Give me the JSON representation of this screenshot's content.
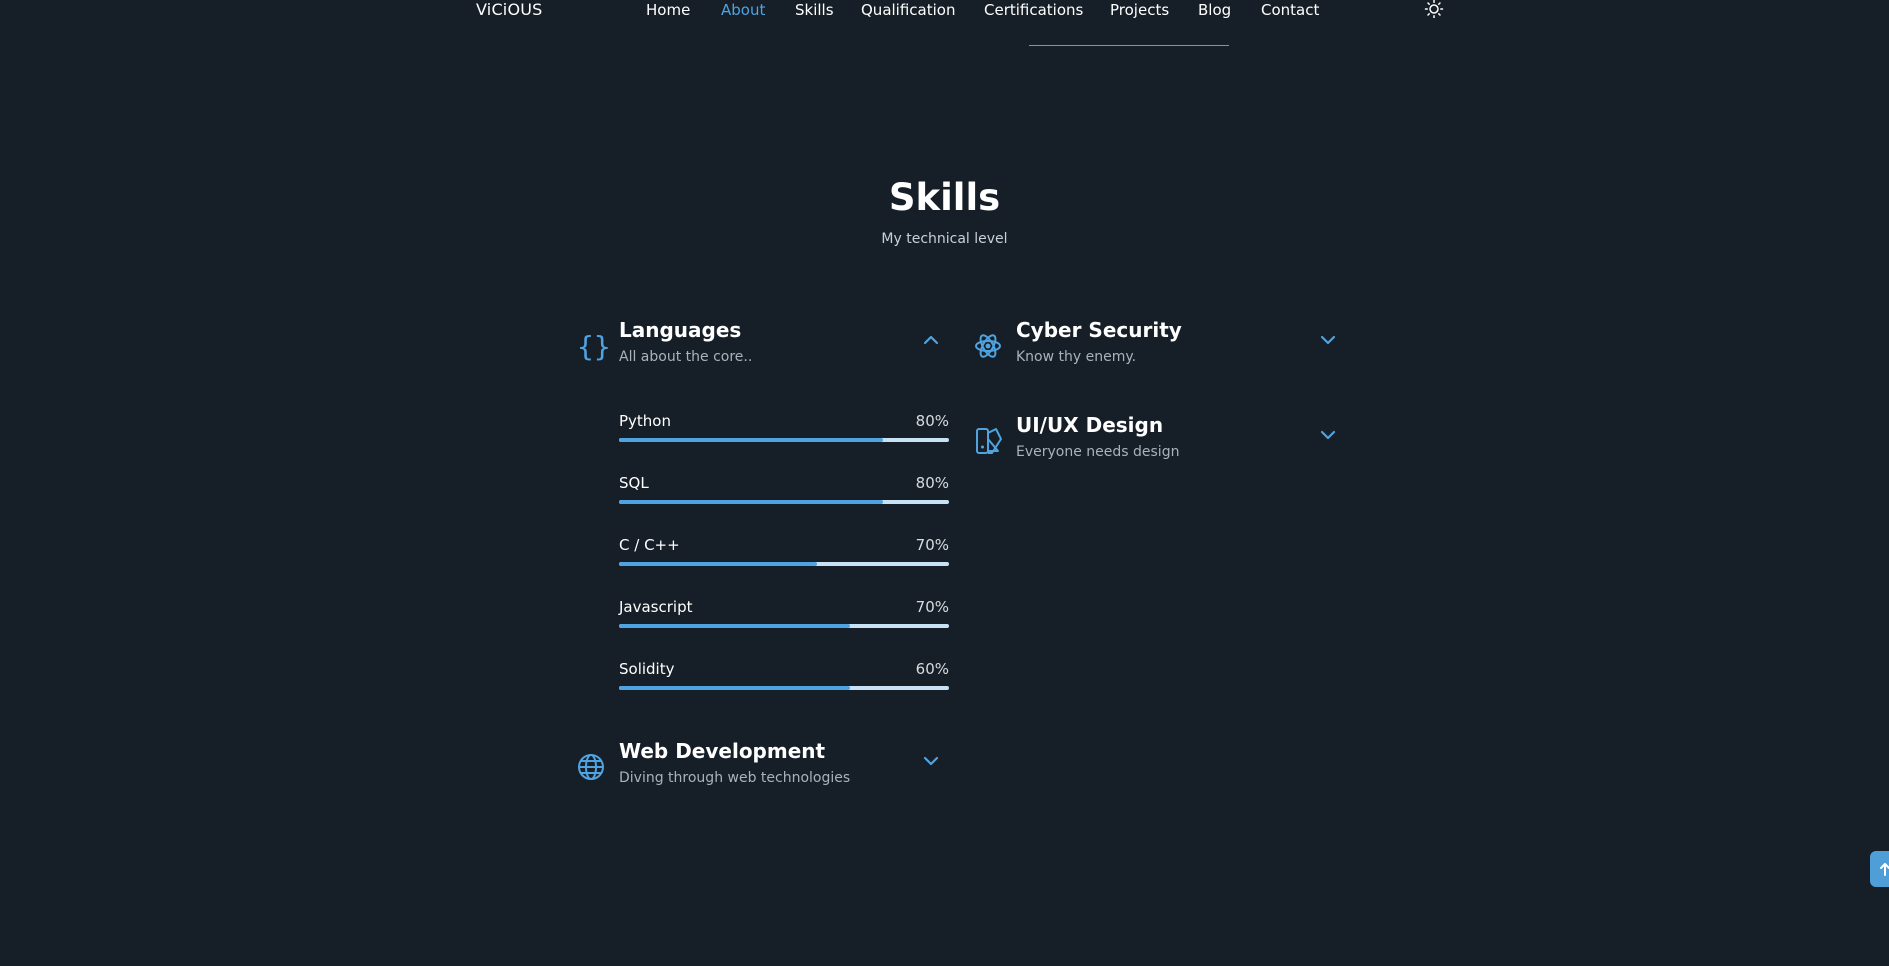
{
  "header": {
    "logo": "ViCiOUS",
    "nav": [
      {
        "label": "Home",
        "active": false
      },
      {
        "label": "About",
        "active": true
      },
      {
        "label": "Skills",
        "active": false
      },
      {
        "label": "Qualification",
        "active": false
      },
      {
        "label": "Certifications",
        "active": false
      },
      {
        "label": "Projects",
        "active": false
      },
      {
        "label": "Blog",
        "active": false
      },
      {
        "label": "Contact",
        "active": false
      }
    ],
    "theme_icon": "sun-icon"
  },
  "section": {
    "title": "Skills",
    "subtitle": "My technical level"
  },
  "groups": {
    "languages": {
      "title": "Languages",
      "subtitle": "All about the core..",
      "icon": "braces-icon",
      "expanded": true,
      "skills": [
        {
          "name": "Python",
          "percent": "80%",
          "level": 0.8
        },
        {
          "name": "SQL",
          "percent": "80%",
          "level": 0.8
        },
        {
          "name": "C / C++",
          "percent": "70%",
          "level": 0.6
        },
        {
          "name": "Javascript",
          "percent": "70%",
          "level": 0.7
        },
        {
          "name": "Solidity",
          "percent": "60%",
          "level": 0.7
        }
      ]
    },
    "web": {
      "title": "Web Development",
      "subtitle": "Diving through web technologies",
      "icon": "globe-icon",
      "expanded": false
    },
    "cyber": {
      "title": "Cyber Security",
      "subtitle": "Know thy enemy.",
      "icon": "atom-icon",
      "expanded": false
    },
    "uiux": {
      "title": "UI/UX Design",
      "subtitle": "Everyone needs design",
      "icon": "design-icon",
      "expanded": false
    }
  },
  "colors": {
    "background": "#161f27",
    "accent": "#4fa3e0",
    "track": "#c7e2f5"
  }
}
